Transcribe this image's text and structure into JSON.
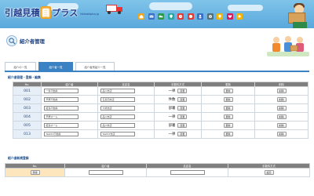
{
  "header": {
    "logo_text": "引越見積",
    "logo_badge": "目",
    "logo_suffix": "プラス",
    "logo_sub": "hikkoshiplus.jp",
    "icons": [
      {
        "name": "home-icon",
        "color": "#f0a61d"
      },
      {
        "name": "mail-icon",
        "color": "#3a6fc7"
      },
      {
        "name": "truck-icon",
        "color": "#2c9a4b"
      },
      {
        "name": "map-icon",
        "color": "#26a69a"
      },
      {
        "name": "clock-icon",
        "color": "#e53935"
      },
      {
        "name": "question-icon",
        "color": "#e53935"
      },
      {
        "name": "person-icon",
        "color": "#3a6fc7"
      },
      {
        "name": "gear-icon",
        "color": "#546e7a"
      },
      {
        "name": "lightbulb-icon",
        "color": "#f4b400"
      },
      {
        "name": "heart-icon",
        "color": "#d81b60"
      },
      {
        "name": "bell-icon",
        "color": "#f4b400"
      }
    ]
  },
  "page": {
    "title": "紹介者管理",
    "tabs": [
      {
        "label": "紹介の一覧",
        "active": false
      },
      {
        "label": "紹介者一覧",
        "active": true
      },
      {
        "label": "紹介者別紹介一覧",
        "active": false
      }
    ]
  },
  "manage": {
    "section_title": "紹介者管理・登録・編集",
    "columns": [
      "No.",
      "紹介者",
      "支店名",
      "手数料方式",
      "更新",
      "削除"
    ],
    "update_label": "変更",
    "row_update_label": "更新",
    "delete_label": "削除",
    "rows": [
      {
        "no": "001",
        "name": "一条不動産",
        "branch": "品川支店",
        "method": "一律"
      },
      {
        "no": "002",
        "name": "芦屋不動産",
        "branch": "五反田支店",
        "method": "件数"
      },
      {
        "no": "003",
        "name": "鮫島不動産",
        "branch": "大崎支店",
        "method": "部署"
      },
      {
        "no": "004",
        "name": "芦屋ホーム",
        "branch": "品川支店",
        "method": "一律"
      },
      {
        "no": "005",
        "name": "鮫島ホーム",
        "branch": "品川支店",
        "method": "部署"
      },
      {
        "no": "013",
        "name": "TestXX不動産",
        "branch": "TestXX支店",
        "method": "一律"
      }
    ]
  },
  "register": {
    "section_title": "紹介者新規登録",
    "columns": [
      "No.",
      "紹介者",
      "支店名",
      "手数料方式"
    ],
    "register_label": "登録",
    "method_label": "設定"
  },
  "colors": {
    "accent": "#3b82c4",
    "header_bg": "#6fb6e4",
    "table_header": "#7f7f7f",
    "no_cell": "#e6eef8",
    "add_no_cell": "#fde6bd"
  }
}
